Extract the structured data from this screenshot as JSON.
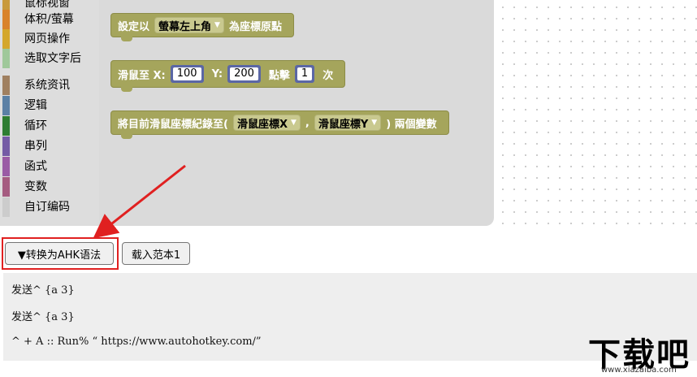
{
  "toolbox": {
    "items": [
      {
        "label": "鼠标视窗",
        "color": "#c89a3c"
      },
      {
        "label": "体积/萤幕",
        "color": "#d9822b"
      },
      {
        "label": "网页操作",
        "color": "#d4a72c"
      },
      {
        "label": "选取文字后",
        "color": "#9fc89a"
      },
      {
        "label": "系统资讯",
        "color": "#a08060"
      },
      {
        "label": "逻辑",
        "color": "#5b80a5"
      },
      {
        "label": "循环",
        "color": "#2e7d32"
      },
      {
        "label": "串列",
        "color": "#745ba5"
      },
      {
        "label": "函式",
        "color": "#9a5ba5"
      },
      {
        "label": "变数",
        "color": "#a55b80"
      },
      {
        "label": "自订编码",
        "color": "#cccccc"
      }
    ]
  },
  "blocks": {
    "b1": {
      "prefix": "設定以",
      "dropdown": "螢幕左上角",
      "suffix": "為座標原點"
    },
    "b2": {
      "label_x": "滑鼠至 X:",
      "x_value": "100",
      "label_y": "Y:",
      "y_value": "200",
      "label_click": "點擊",
      "click_value": "1",
      "label_times": "次"
    },
    "b3": {
      "prefix": "將目前滑鼠座標紀錄至(",
      "dd1": "滑鼠座標X",
      "comma": ",",
      "dd2": "滑鼠座標Y",
      "suffix": ") 兩個變數"
    }
  },
  "buttons": {
    "convert": "▼转换为AHK语法",
    "load_sample": "载入范本1"
  },
  "output": {
    "lines": [
      "发送^ {a 3}",
      "发送^ {a 3}",
      "^ + A :: Run% “ https://www.autohotkey.com/”"
    ]
  },
  "watermark": {
    "logo_text": "下载吧",
    "domain": "www.xiazaiba.com"
  },
  "colors": {
    "block": "#a5a55c",
    "number_block": "#5b67a5",
    "highlight": "#e02020",
    "toolbox_bg": "#dddddd",
    "flyout_bg": "#dadada",
    "output_bg": "#eeeeee"
  }
}
